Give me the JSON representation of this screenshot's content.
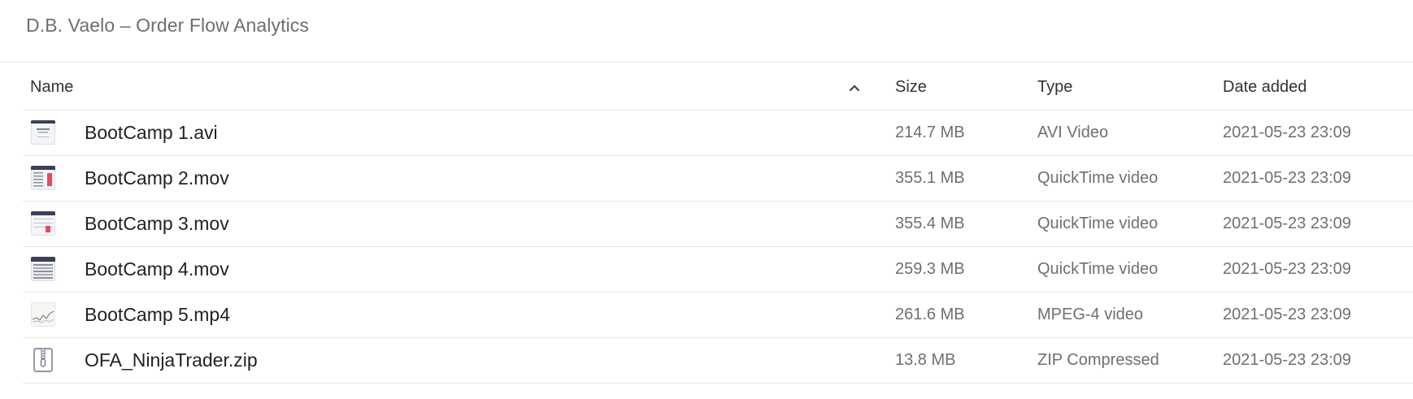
{
  "page": {
    "title": "D.B. Vaelo – Order Flow Analytics"
  },
  "table": {
    "columns": {
      "name": "Name",
      "size": "Size",
      "type": "Type",
      "date": "Date added"
    },
    "sort": {
      "column": "name",
      "direction": "ascending",
      "icon": "chevron-up-icon"
    },
    "rows": [
      {
        "name": "BootCamp 1.avi",
        "size": "214.7 MB",
        "type": "AVI Video",
        "date": "2021-05-23 23:09",
        "icon": "video-thumbnail-icon"
      },
      {
        "name": "BootCamp 2.mov",
        "size": "355.1 MB",
        "type": "QuickTime video",
        "date": "2021-05-23 23:09",
        "icon": "video-thumbnail-icon"
      },
      {
        "name": "BootCamp 3.mov",
        "size": "355.4 MB",
        "type": "QuickTime video",
        "date": "2021-05-23 23:09",
        "icon": "video-thumbnail-icon"
      },
      {
        "name": "BootCamp 4.mov",
        "size": "259.3 MB",
        "type": "QuickTime video",
        "date": "2021-05-23 23:09",
        "icon": "video-thumbnail-icon"
      },
      {
        "name": "BootCamp 5.mp4",
        "size": "261.6 MB",
        "type": "MPEG-4 video",
        "date": "2021-05-23 23:09",
        "icon": "video-thumbnail-icon"
      },
      {
        "name": "OFA_NinjaTrader.zip",
        "size": "13.8 MB",
        "type": "ZIP Compressed",
        "date": "2021-05-23 23:09",
        "icon": "zip-archive-icon"
      }
    ]
  },
  "colors": {
    "title_text": "#6e6e6e",
    "name_text": "#222222",
    "meta_text": "#6f6f6f",
    "divider": "#e6e6e6"
  }
}
